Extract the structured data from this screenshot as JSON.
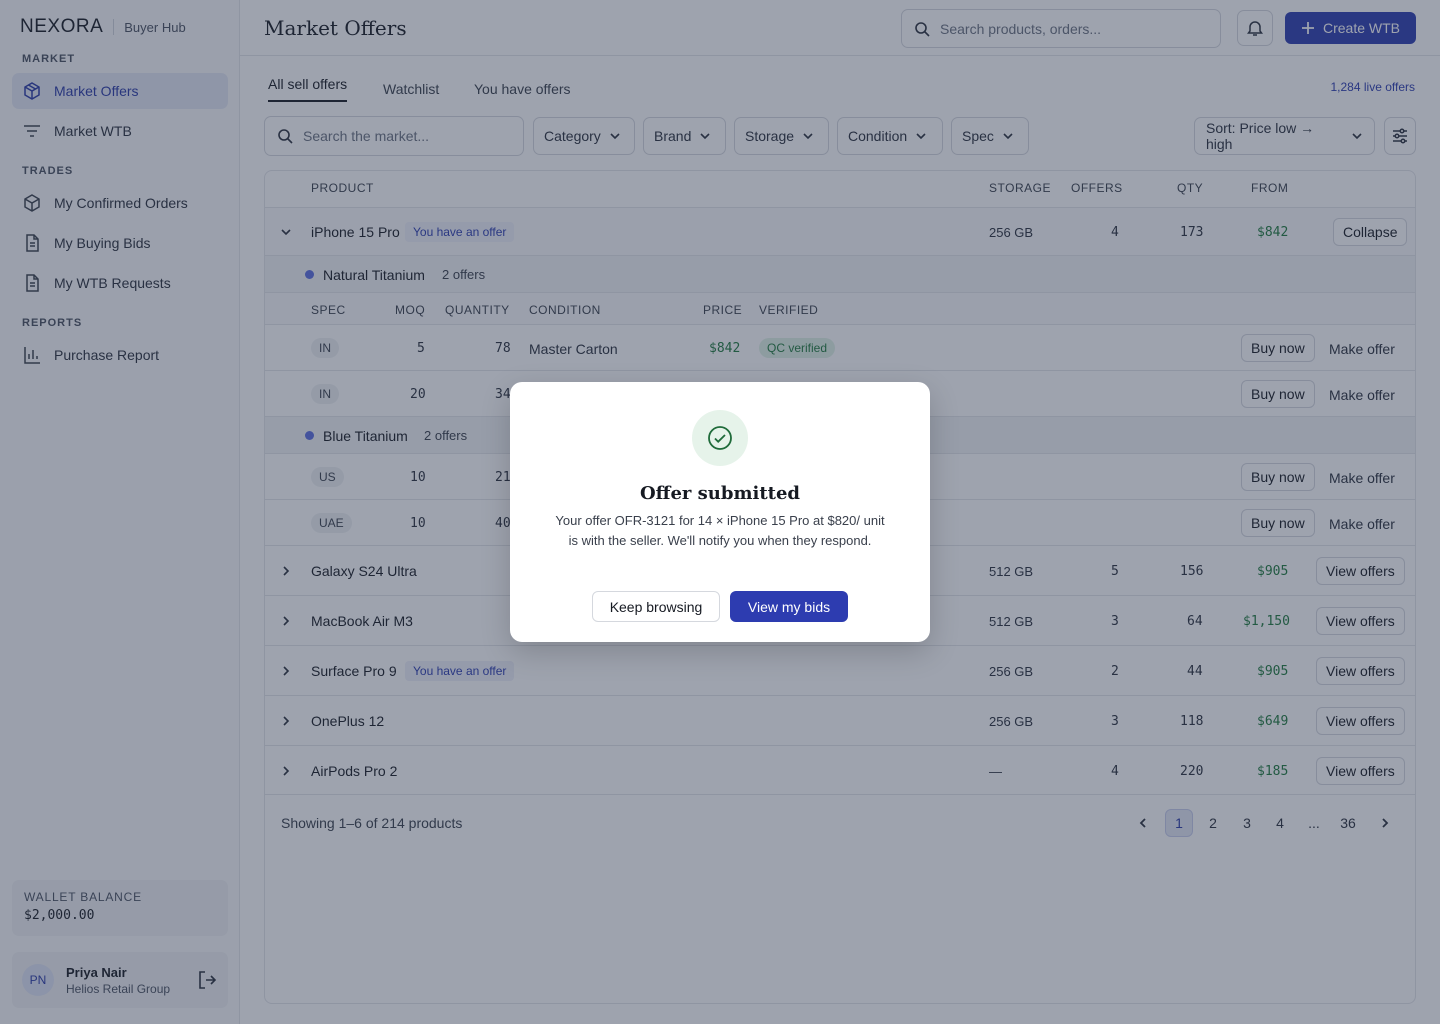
{
  "brand": {
    "name": "NEXORA",
    "sub": "Buyer Hub"
  },
  "sidebar": {
    "sections": [
      {
        "title": "MARKET",
        "items": [
          {
            "label": "Market Offers",
            "icon": "box-icon",
            "active": true
          },
          {
            "label": "Market WTB",
            "icon": "filter-lines-icon",
            "active": false
          }
        ]
      },
      {
        "title": "TRADES",
        "items": [
          {
            "label": "My Confirmed Orders",
            "icon": "package-icon"
          },
          {
            "label": "My Buying Bids",
            "icon": "document-icon"
          },
          {
            "label": "My WTB Requests",
            "icon": "document-icon"
          }
        ]
      },
      {
        "title": "REPORTS",
        "items": [
          {
            "label": "Purchase Report",
            "icon": "bar-chart-icon"
          }
        ]
      }
    ],
    "wallet": {
      "label": "WALLET BALANCE",
      "value": "$2,000.00"
    },
    "user": {
      "initials": "PN",
      "name": "Priya Nair",
      "org": "Helios Retail Group"
    }
  },
  "header": {
    "title": "Market Offers",
    "search_placeholder": "Search products, orders...",
    "create_label": "Create WTB"
  },
  "tabs": [
    "All sell offers",
    "Watchlist",
    "You have offers"
  ],
  "live_count": "1,284 live offers",
  "filters": {
    "search_placeholder": "Search the market...",
    "dropdowns": [
      "Category",
      "Brand",
      "Storage",
      "Condition",
      "Spec"
    ],
    "sort": "Sort: Price low → high"
  },
  "table": {
    "headers": {
      "product": "PRODUCT",
      "storage": "STORAGE",
      "offers": "OFFERS",
      "qty": "QTY",
      "from": "FROM"
    },
    "expanded": {
      "name": "iPhone 15 Pro",
      "badge": "You have an offer",
      "storage": "256 GB",
      "offers": "4",
      "qty": "173",
      "from": "$842",
      "action": "Collapse",
      "sub_headers": {
        "spec": "SPEC",
        "moq": "MOQ",
        "quantity": "QUANTITY",
        "condition": "CONDITION",
        "price": "PRICE",
        "verified": "VERIFIED"
      },
      "groups": [
        {
          "color": "Natural Titanium",
          "count": "2 offers",
          "dot": "#5b6ee0",
          "rows": [
            {
              "spec": "IN",
              "moq": "5",
              "qty": "78",
              "condition": "Master Carton",
              "price": "$842",
              "verified": "QC verified"
            },
            {
              "spec": "IN",
              "moq": "20",
              "qty": "34"
            }
          ]
        },
        {
          "color": "Blue Titanium",
          "count": "2 offers",
          "dot": "#5b6ee0",
          "rows": [
            {
              "spec": "US",
              "moq": "10",
              "qty": "21"
            },
            {
              "spec": "UAE",
              "moq": "10",
              "qty": "40"
            }
          ]
        }
      ],
      "buy_label": "Buy now",
      "offer_label": "Make offer"
    },
    "rows": [
      {
        "name": "Galaxy S24 Ultra",
        "badge": "",
        "storage": "512 GB",
        "offers": "5",
        "qty": "156",
        "from": "$905"
      },
      {
        "name": "MacBook Air M3",
        "badge": "",
        "storage": "512 GB",
        "offers": "3",
        "qty": "64",
        "from": "$1,150"
      },
      {
        "name": "Surface Pro 9",
        "badge": "You have an offer",
        "storage": "256 GB",
        "offers": "2",
        "qty": "44",
        "from": "$905"
      },
      {
        "name": "OnePlus 12",
        "badge": "",
        "storage": "256 GB",
        "offers": "3",
        "qty": "118",
        "from": "$649"
      },
      {
        "name": "AirPods Pro 2",
        "badge": "",
        "storage": "—",
        "offers": "4",
        "qty": "220",
        "from": "$185"
      }
    ],
    "view_label": "View offers",
    "showing": "Showing 1–6 of 214 products",
    "pages": [
      "1",
      "2",
      "3",
      "4",
      "...",
      "36"
    ]
  },
  "modal": {
    "title": "Offer submitted",
    "body": "Your offer OFR-3121 for 14 × iPhone 15 Pro at $820/ unit is with the seller. We'll notify you when they respond.",
    "keep_label": "Keep browsing",
    "view_label": "View my bids"
  },
  "colors": {
    "accent": "#2d3cb0",
    "price": "#1f7a3d"
  }
}
